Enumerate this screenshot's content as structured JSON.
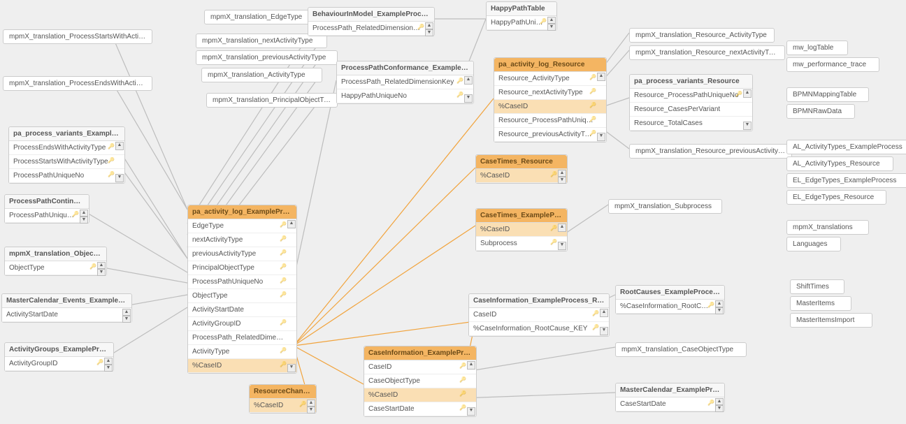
{
  "pills": {
    "p1": "mpmX_translation_ProcessStartsWithActivityType",
    "p2": "mpmX_translation_ProcessEndsWithActivityType",
    "p3": "mpmX_translation_EdgeType",
    "p4": "mpmX_translation_nextActivityType",
    "p5": "mpmX_translation_previousActivityType",
    "p6": "mpmX_translation_ActivityType",
    "p7": "mpmX_translation_PrincipalObjectType",
    "p8": "mpmX_translation_Resource_ActivityType",
    "p9": "mpmX_translation_Resource_nextActivityType",
    "p10": "mpmX_translation_Resource_previousActivityType",
    "p11": "mpmX_translation_Subprocess",
    "p12": "mpmX_translation_CaseObjectType",
    "p13": "mw_logTable",
    "p14": "mw_performance_trace",
    "p15": "BPMNMappingTable",
    "p16": "BPMNRawData",
    "p17": "AL_ActivityTypes_ExampleProcess",
    "p18": "AL_ActivityTypes_Resource",
    "p19": "EL_EdgeTypes_ExampleProcess",
    "p20": "EL_EdgeTypes_Resource",
    "p21": "mpmX_translations",
    "p22": "Languages",
    "p23": "ShiftTimes",
    "p24": "MasterItems",
    "p25": "MasterItemsImport"
  },
  "tables": {
    "behaviourInModel": {
      "title": "BehaviourInModel_ExampleProcess",
      "rows": [
        {
          "label": "ProcessPath_RelatedDimensionKey",
          "key": true
        }
      ]
    },
    "happyPathTable": {
      "title": "HappyPathTable",
      "rows": [
        {
          "label": "HappyPathUniqueN...",
          "key": true
        }
      ]
    },
    "processPathConformance": {
      "title": "ProcessPathConformance_ExampleProcess",
      "rows": [
        {
          "label": "ProcessPath_RelatedDimensionKey",
          "key": true
        },
        {
          "label": "HappyPathUniqueNo",
          "key": true
        }
      ]
    },
    "paProcessVariantsEP": {
      "title": "pa_process_variants_ExampleProcess",
      "rows": [
        {
          "label": "ProcessEndsWithActivityType",
          "key": true
        },
        {
          "label": "ProcessStartsWithActivityType",
          "key": true
        },
        {
          "label": "ProcessPathUniqueNo",
          "key": true
        }
      ]
    },
    "processPathContinuation": {
      "title": "ProcessPathContinuation",
      "rows": [
        {
          "label": "ProcessPathUniqueNo",
          "key": true
        }
      ]
    },
    "mpmxObjectType": {
      "title": "mpmX_translation_ObjectType",
      "rows": [
        {
          "label": "ObjectType",
          "key": true
        }
      ]
    },
    "masterCalendarEvents": {
      "title": "MasterCalendar_Events_ExampleProcess",
      "rows": [
        {
          "label": "ActivityStartDate"
        }
      ]
    },
    "activityGroups": {
      "title": "ActivityGroups_ExampleProcess",
      "rows": [
        {
          "label": "ActivityGroupID",
          "key": true
        }
      ]
    },
    "paActivityLogEP": {
      "title": "pa_activity_log_ExampleProcess",
      "rows": [
        {
          "label": "EdgeType",
          "key": true
        },
        {
          "label": "nextActivityType",
          "key": true
        },
        {
          "label": "previousActivityType",
          "key": true
        },
        {
          "label": "PrincipalObjectType",
          "key": true
        },
        {
          "label": "ProcessPathUniqueNo",
          "key": true
        },
        {
          "label": "ObjectType",
          "key": true
        },
        {
          "label": "ActivityStartDate"
        },
        {
          "label": "ActivityGroupID",
          "key": true
        },
        {
          "label": "ProcessPath_RelatedDimensionK..."
        },
        {
          "label": "ActivityType",
          "key": true
        },
        {
          "label": "%CaseID",
          "key": true,
          "hl": true
        }
      ]
    },
    "resourceChanges": {
      "title": "ResourceChanges",
      "rows": [
        {
          "label": "%CaseID",
          "key": true,
          "hl": true
        }
      ]
    },
    "paActivityLogResource": {
      "title": "pa_activity_log_Resource",
      "rows": [
        {
          "label": "Resource_ActivityType",
          "key": true
        },
        {
          "label": "Resource_nextActivityType",
          "key": true
        },
        {
          "label": "%CaseID",
          "key": true,
          "hl": true
        },
        {
          "label": "Resource_ProcessPathUniqueNo",
          "key": true
        },
        {
          "label": "Resource_previousActivityType",
          "key": true
        }
      ]
    },
    "paProcessVariantsResource": {
      "title": "pa_process_variants_Resource",
      "rows": [
        {
          "label": "Resource_ProcessPathUniqueNo",
          "key": true
        },
        {
          "label": "Resource_CasesPerVariant"
        },
        {
          "label": "Resource_TotalCases"
        }
      ]
    },
    "caseTimesResource": {
      "title": "CaseTimes_Resource",
      "rows": [
        {
          "label": "%CaseID",
          "key": true,
          "hl": true
        }
      ]
    },
    "caseTimesEP": {
      "title": "CaseTimes_ExampleProcess",
      "rows": [
        {
          "label": "%CaseID",
          "key": true,
          "hl": true
        },
        {
          "label": "Subprocess",
          "key": true
        }
      ]
    },
    "caseInfoRCA": {
      "title": "CaseInformation_ExampleProcess_RCA_LinkTable",
      "rows": [
        {
          "label": "CaseID",
          "key": true
        },
        {
          "label": "%CaseInformation_RootCause_KEY",
          "key": true
        }
      ]
    },
    "rootCauses": {
      "title": "RootCauses_ExampleProcess",
      "rows": [
        {
          "label": "%CaseInformation_RootCause_K...",
          "key": true
        }
      ]
    },
    "caseInfoEP": {
      "title": "CaseInformation_ExampleProcess",
      "rows": [
        {
          "label": "CaseID",
          "key": true
        },
        {
          "label": "CaseObjectType",
          "key": true
        },
        {
          "label": "%CaseID",
          "key": true,
          "hl": true
        },
        {
          "label": "CaseStartDate",
          "key": true
        }
      ]
    },
    "masterCalendarEP": {
      "title": "MasterCalendar_ExampleProcess",
      "rows": [
        {
          "label": "CaseStartDate",
          "key": true
        }
      ]
    }
  }
}
